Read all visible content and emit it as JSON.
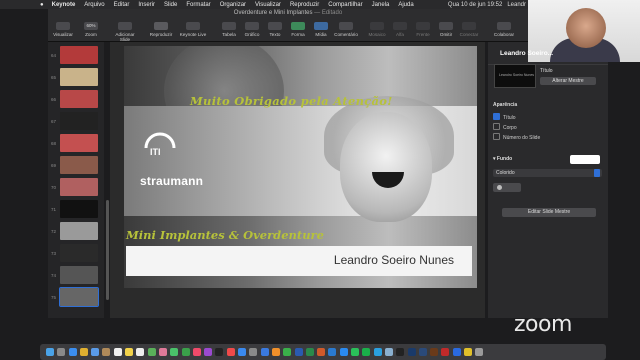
{
  "menubar": {
    "apple": "",
    "app": "Keynote",
    "items": [
      "Arquivo",
      "Editar",
      "Inserir",
      "Slide",
      "Formatar",
      "Organizar",
      "Visualizar",
      "Reproduzir",
      "Compartilhar",
      "Janela",
      "Ajuda"
    ],
    "datetime": "Qua 10 de jun  19:52",
    "user": "Leandr"
  },
  "document": {
    "title": "Overdenture e Mini Implantes",
    "state": "Editado"
  },
  "toolbar": {
    "items": [
      {
        "label": "Visualizar",
        "enabled": true
      },
      {
        "label": "Zoom",
        "enabled": true,
        "value": "60%"
      },
      {
        "label": "Adicionar Slide",
        "enabled": true
      },
      {
        "label": "Reproduzir",
        "enabled": true
      },
      {
        "label": "Keynote Live",
        "enabled": true
      },
      {
        "label": "Tabela",
        "enabled": true
      },
      {
        "label": "Gráfico",
        "enabled": true
      },
      {
        "label": "Texto",
        "enabled": true
      },
      {
        "label": "Forma",
        "enabled": true
      },
      {
        "label": "Mídia",
        "enabled": true
      },
      {
        "label": "Comentário",
        "enabled": true
      },
      {
        "label": "Mosaico",
        "enabled": false
      },
      {
        "label": "Alfa",
        "enabled": false
      },
      {
        "label": "Frente",
        "enabled": false
      },
      {
        "label": "Omitir",
        "enabled": true
      },
      {
        "label": "Conectar",
        "enabled": false
      },
      {
        "label": "Colaborar",
        "enabled": true
      }
    ]
  },
  "slides": [
    {
      "number": "64",
      "color": "#b33a3a"
    },
    {
      "number": "65",
      "color": "#c9b38a"
    },
    {
      "number": "66",
      "color": "#b84848"
    },
    {
      "number": "67",
      "color": "#222222"
    },
    {
      "number": "68",
      "color": "#c45050"
    },
    {
      "number": "69",
      "color": "#8a5a4a"
    },
    {
      "number": "70",
      "color": "#b06060"
    },
    {
      "number": "71",
      "color": "#111111"
    },
    {
      "number": "72",
      "color": "#9a9a9a"
    },
    {
      "number": "73",
      "color": "#2a2a2a"
    },
    {
      "number": "74",
      "color": "#555555"
    },
    {
      "number": "75",
      "color": "#666666"
    }
  ],
  "slide": {
    "thanks": "Muito Obrigado pela Atenção!",
    "logo_iti": "ITI",
    "logo_straumann": "straumann",
    "subtitle": "Mini Implantes & Overdenture",
    "author": "Leandro Soeiro Nunes"
  },
  "inspector": {
    "layout_label": "Título",
    "layout_thumb_text": "Leandro Soeiro Nunes",
    "change_master": "Alterar Mestre",
    "appearance_heading": "Aparência",
    "checkboxes": [
      {
        "label": "Título",
        "checked": true
      },
      {
        "label": "Corpo",
        "checked": false
      },
      {
        "label": "Número do Slide",
        "checked": false
      }
    ],
    "background_heading": "Fundo",
    "fill_type": "Colorido",
    "edit_master": "Editar Slide Mestre"
  },
  "video": {
    "participant_name": "Leandro Soeiro..."
  },
  "zoom_logo": "zoom",
  "colors": {
    "accent_green": "#b7c23a",
    "selection_blue": "#2f6fd6"
  },
  "dock_icons": [
    "finder-icon",
    "launchpad-icon",
    "safari-icon",
    "chrome-icon",
    "mail-icon",
    "contacts-icon",
    "calendar-icon",
    "notes-icon",
    "reminders-icon",
    "maps-icon",
    "photos-icon",
    "messages-icon",
    "facetime-icon",
    "music-icon",
    "podcasts-icon",
    "tv-icon",
    "news-icon",
    "appstore-icon",
    "settings-icon",
    "keynote-icon",
    "pages-icon",
    "numbers-icon",
    "word-icon",
    "excel-icon",
    "powerpoint-icon",
    "outlook-icon",
    "zoom-icon",
    "whatsapp-icon",
    "spotify-icon",
    "skype-icon",
    "preview-icon",
    "terminal-icon",
    "photoshop-icon",
    "lightroom-icon",
    "illustrator-icon",
    "acrobat-icon",
    "dropbox-icon",
    "drive-icon",
    "trash-icon"
  ]
}
